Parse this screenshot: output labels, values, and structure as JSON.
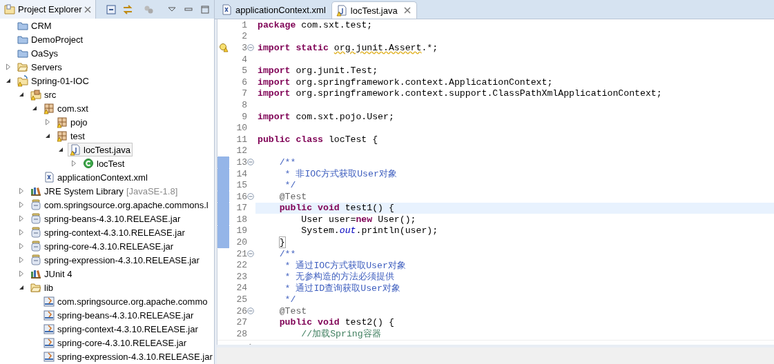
{
  "explorer": {
    "title": "Project Explorer",
    "tree": [
      {
        "label": "CRM",
        "kind": "project",
        "selected": false,
        "warning": false
      },
      {
        "label": "DemoProject",
        "kind": "project",
        "selected": false,
        "warning": false
      },
      {
        "label": "OaSys",
        "kind": "project",
        "selected": false,
        "warning": false
      },
      {
        "label": "Servers",
        "kind": "folder",
        "expanded": false,
        "selected": false,
        "warning": false
      },
      {
        "label": "Spring-01-IOC",
        "kind": "java-project",
        "expanded": true,
        "selected": false,
        "warning": true,
        "children": [
          {
            "label": "src",
            "kind": "source-folder",
            "expanded": true,
            "selected": false,
            "warning": true,
            "children": [
              {
                "label": "com.sxt",
                "kind": "package",
                "expanded": true,
                "selected": false,
                "warning": true,
                "children": [
                  {
                    "label": "pojo",
                    "kind": "package",
                    "expanded": false,
                    "selected": false,
                    "warning": true
                  },
                  {
                    "label": "test",
                    "kind": "package",
                    "expanded": true,
                    "selected": false,
                    "warning": true,
                    "children": [
                      {
                        "label": "locTest.java",
                        "kind": "java-file",
                        "expanded": true,
                        "selected": true,
                        "warning": true,
                        "children": [
                          {
                            "label": "locTest",
                            "kind": "class",
                            "expanded": false,
                            "selected": false,
                            "warning": false
                          }
                        ]
                      }
                    ]
                  }
                ]
              },
              {
                "label": "applicationContext.xml",
                "kind": "xml-file",
                "selected": false,
                "warning": false
              }
            ]
          },
          {
            "label": "JRE System Library",
            "decoration": "[JavaSE-1.8]",
            "kind": "library",
            "expanded": false,
            "selected": false,
            "warning": false
          },
          {
            "label": "com.springsource.org.apache.commons.l",
            "kind": "jar",
            "expanded": false,
            "selected": false,
            "warning": false
          },
          {
            "label": "spring-beans-4.3.10.RELEASE.jar",
            "kind": "jar",
            "expanded": false,
            "selected": false,
            "warning": false
          },
          {
            "label": "spring-context-4.3.10.RELEASE.jar",
            "kind": "jar",
            "expanded": false,
            "selected": false,
            "warning": false
          },
          {
            "label": "spring-core-4.3.10.RELEASE.jar",
            "kind": "jar",
            "expanded": false,
            "selected": false,
            "warning": false
          },
          {
            "label": "spring-expression-4.3.10.RELEASE.jar",
            "kind": "jar",
            "expanded": false,
            "selected": false,
            "warning": false
          },
          {
            "label": "JUnit 4",
            "kind": "library",
            "expanded": false,
            "selected": false,
            "warning": false
          },
          {
            "label": "lib",
            "kind": "folder",
            "expanded": true,
            "selected": false,
            "warning": false,
            "children": [
              {
                "label": "com.springsource.org.apache.commo",
                "kind": "jar-file",
                "selected": false,
                "warning": false
              },
              {
                "label": "spring-beans-4.3.10.RELEASE.jar",
                "kind": "jar-file",
                "selected": false,
                "warning": false
              },
              {
                "label": "spring-context-4.3.10.RELEASE.jar",
                "kind": "jar-file",
                "selected": false,
                "warning": false
              },
              {
                "label": "spring-core-4.3.10.RELEASE.jar",
                "kind": "jar-file",
                "selected": false,
                "warning": false
              },
              {
                "label": "spring-expression-4.3.10.RELEASE.jar",
                "kind": "jar-file",
                "selected": false,
                "warning": false
              }
            ]
          }
        ]
      }
    ]
  },
  "editor": {
    "tabs": [
      {
        "label": "applicationContext.xml",
        "kind": "xml-file",
        "selected": false
      },
      {
        "label": "locTest.java",
        "kind": "java-file",
        "selected": true
      }
    ],
    "lines": [
      {
        "number": "1",
        "current": false,
        "changed": false,
        "foldable": false,
        "warning": false,
        "segments": [
          {
            "text": "package",
            "kind": "keyword"
          },
          {
            "text": " com.sxt.test;",
            "kind": "plain"
          }
        ]
      },
      {
        "number": "2",
        "current": false,
        "changed": false,
        "foldable": false,
        "warning": false
      },
      {
        "number": "3",
        "current": false,
        "changed": false,
        "foldable": true,
        "warning": true,
        "segments": [
          {
            "text": "import static",
            "kind": "keyword"
          },
          {
            "text": " org.junit.Assert",
            "kind": "warning"
          },
          {
            "text": ".*;",
            "kind": "plain"
          }
        ]
      },
      {
        "number": "4",
        "current": false,
        "changed": false,
        "foldable": false,
        "warning": false
      },
      {
        "number": "5",
        "current": false,
        "changed": false,
        "foldable": false,
        "warning": false,
        "segments": [
          {
            "text": "import",
            "kind": "keyword"
          },
          {
            "text": " org.junit.Test;",
            "kind": "plain"
          }
        ]
      },
      {
        "number": "6",
        "current": false,
        "changed": false,
        "foldable": false,
        "warning": false,
        "segments": [
          {
            "text": "import",
            "kind": "keyword"
          },
          {
            "text": " org.springframework.context.ApplicationContext;",
            "kind": "plain"
          }
        ]
      },
      {
        "number": "7",
        "current": false,
        "changed": false,
        "foldable": false,
        "warning": false,
        "segments": [
          {
            "text": "import",
            "kind": "keyword"
          },
          {
            "text": " org.springframework.context.support.ClassPathXmlApplicationContext;",
            "kind": "plain"
          }
        ]
      },
      {
        "number": "8",
        "current": false,
        "changed": false,
        "foldable": false,
        "warning": false
      },
      {
        "number": "9",
        "current": false,
        "changed": false,
        "foldable": false,
        "warning": false,
        "segments": [
          {
            "text": "import",
            "kind": "keyword"
          },
          {
            "text": " com.sxt.pojo.User;",
            "kind": "plain"
          }
        ]
      },
      {
        "number": "10",
        "current": false,
        "changed": false,
        "foldable": false,
        "warning": false
      },
      {
        "number": "11",
        "current": false,
        "changed": false,
        "foldable": false,
        "warning": false,
        "segments": [
          {
            "text": "public class",
            "kind": "keyword"
          },
          {
            "text": " locTest {",
            "kind": "plain"
          }
        ]
      },
      {
        "number": "12",
        "current": false,
        "changed": false,
        "foldable": false,
        "warning": false
      },
      {
        "number": "13",
        "current": false,
        "changed": true,
        "foldable": true,
        "warning": false,
        "segments": [
          {
            "text": "    /**",
            "kind": "doc"
          }
        ]
      },
      {
        "number": "14",
        "current": false,
        "changed": true,
        "foldable": false,
        "warning": false,
        "segments": [
          {
            "text": "     * 非IOC方式获取User对象",
            "kind": "doc"
          }
        ]
      },
      {
        "number": "15",
        "current": false,
        "changed": true,
        "foldable": false,
        "warning": false,
        "segments": [
          {
            "text": "     */",
            "kind": "doc"
          }
        ]
      },
      {
        "number": "16",
        "current": false,
        "changed": true,
        "foldable": true,
        "warning": false,
        "segments": [
          {
            "text": "    @Test",
            "kind": "annotation"
          }
        ]
      },
      {
        "number": "17",
        "current": true,
        "changed": true,
        "foldable": false,
        "warning": false,
        "segments": [
          {
            "text": "    public void",
            "kind": "keyword"
          },
          {
            "text": " test1() {",
            "kind": "plain"
          }
        ]
      },
      {
        "number": "18",
        "current": false,
        "changed": true,
        "foldable": false,
        "warning": false,
        "segments": [
          {
            "text": "        User user=",
            "kind": "plain"
          },
          {
            "text": "new",
            "kind": "keyword"
          },
          {
            "text": " User();",
            "kind": "plain"
          }
        ]
      },
      {
        "number": "19",
        "current": false,
        "changed": true,
        "foldable": false,
        "warning": false,
        "segments": [
          {
            "text": "        System.",
            "kind": "plain"
          },
          {
            "text": "out",
            "kind": "field"
          },
          {
            "text": ".println(user);",
            "kind": "plain"
          }
        ]
      },
      {
        "number": "20",
        "current": false,
        "changed": true,
        "foldable": false,
        "warning": false,
        "segments": [
          {
            "text": "    }",
            "kind": "bracket-match"
          }
        ]
      },
      {
        "number": "21",
        "current": false,
        "changed": false,
        "foldable": true,
        "warning": false,
        "segments": [
          {
            "text": "    /**",
            "kind": "doc"
          }
        ]
      },
      {
        "number": "22",
        "current": false,
        "changed": false,
        "foldable": false,
        "warning": false,
        "segments": [
          {
            "text": "     * 通过IOC方式获取User对象",
            "kind": "doc"
          }
        ]
      },
      {
        "number": "23",
        "current": false,
        "changed": false,
        "foldable": false,
        "warning": false,
        "segments": [
          {
            "text": "     * 无参构造的方法必须提供",
            "kind": "doc"
          }
        ]
      },
      {
        "number": "24",
        "current": false,
        "changed": false,
        "foldable": false,
        "warning": false,
        "segments": [
          {
            "text": "     * 通过ID查询获取User对象",
            "kind": "doc"
          }
        ]
      },
      {
        "number": "25",
        "current": false,
        "changed": false,
        "foldable": false,
        "warning": false,
        "segments": [
          {
            "text": "     */",
            "kind": "doc"
          }
        ]
      },
      {
        "number": "26",
        "current": false,
        "changed": false,
        "foldable": true,
        "warning": false,
        "segments": [
          {
            "text": "    @Test",
            "kind": "annotation"
          }
        ]
      },
      {
        "number": "27",
        "current": false,
        "changed": false,
        "foldable": false,
        "warning": false,
        "segments": [
          {
            "text": "    public void",
            "kind": "keyword"
          },
          {
            "text": " test2() {",
            "kind": "plain"
          }
        ]
      },
      {
        "number": "28",
        "current": false,
        "changed": false,
        "foldable": false,
        "warning": false,
        "segments": [
          {
            "text": "        //加载Spring容器",
            "kind": "comment"
          }
        ]
      }
    ]
  }
}
